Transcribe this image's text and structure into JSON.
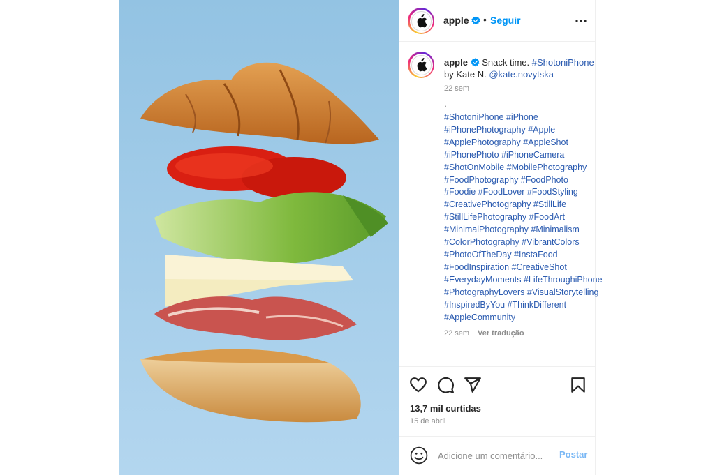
{
  "post": {
    "username": "apple",
    "follow_label": "Seguir",
    "separator": "•",
    "caption": {
      "text": "Snack time.",
      "tag_main": "#ShotoniPhone",
      "by_text": "by Kate N.",
      "mention": "@kate.novytska",
      "time": "22 sem",
      "dot": ".",
      "hashtag_lines": [
        "#ShotoniPhone #iPhone",
        "#iPhonePhotography #Apple",
        "#ApplePhotography #AppleShot",
        "#iPhonePhoto #iPhoneCamera",
        "#ShotOnMobile #MobilePhotography",
        "#FoodPhotography #FoodPhoto",
        "#Foodie #FoodLover #FoodStyling",
        "#CreativePhotography #StillLife",
        "#StillLifePhotography #FoodArt",
        "#MinimalPhotography #Minimalism",
        "#ColorPhotography #VibrantColors",
        "#PhotoOfTheDay #InstaFood",
        "#FoodInspiration #CreativeShot",
        "#EverydayMoments #LifeThroughiPhone",
        "#PhotographyLovers #VisualStorytelling",
        "#InspiredByYou #ThinkDifferent",
        "#AppleCommunity"
      ],
      "time2": "22 sem",
      "translate_label": "Ver tradução"
    },
    "likes": "13,7 mil curtidas",
    "date": "15 de abril",
    "comment_placeholder": "Adicione um comentário...",
    "post_label": "Postar"
  },
  "icons": {
    "header_avatar": "apple-logo-icon",
    "verified": "verified-badge-icon",
    "more": "more-options-icon",
    "like": "heart-icon",
    "comment": "comment-icon",
    "share": "paper-plane-icon",
    "save": "bookmark-icon",
    "emoji": "emoji-icon"
  },
  "colors": {
    "link_blue": "#0095f6",
    "hashtag_blue": "#2b5bb0",
    "muted": "#8e8e8e",
    "post_disabled": "#7ab8f5",
    "photo_background": "#9ec6e2"
  }
}
